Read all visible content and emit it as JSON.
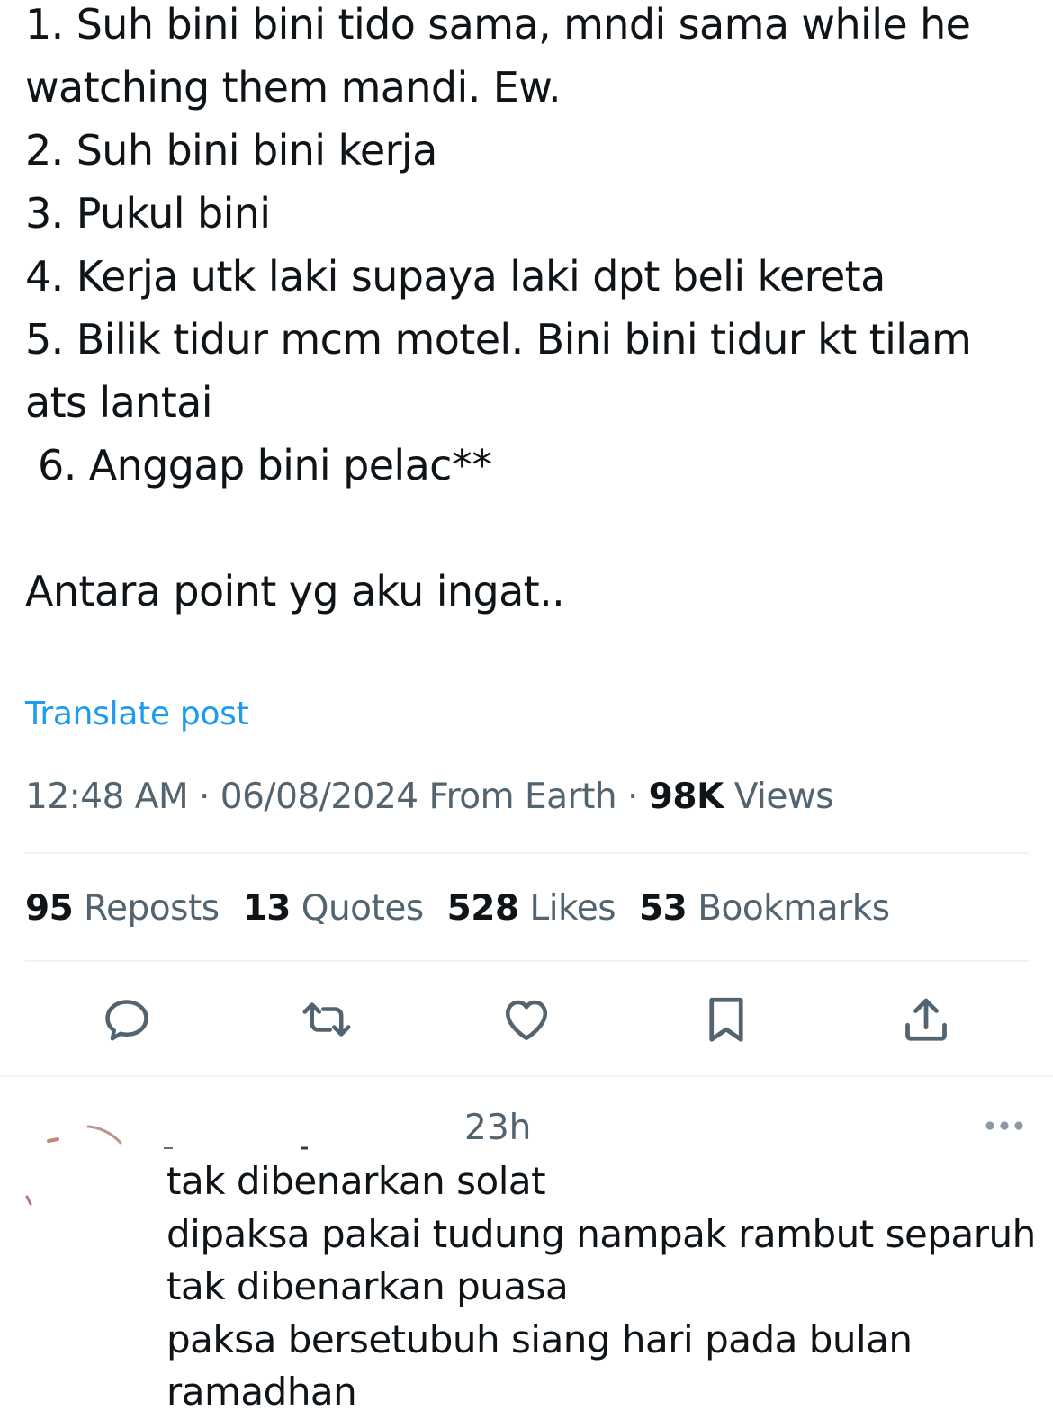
{
  "tweet": {
    "lines": [
      "1. Suh bini bini tido sama, mndi sama while he",
      "watching them mandi. Ew.",
      "2. Suh bini bini kerja",
      "3. Pukul bini",
      "4. Kerja utk laki supaya laki dpt beli kereta",
      "5. Bilik tidur mcm motel. Bini bini tidur kt tilam",
      "ats lantai",
      " 6. Anggap bini pelac**",
      "",
      "Antara point yg aku ingat.."
    ],
    "translate_label": "Translate post",
    "timestamp": "12:48 AM · 06/08/2024 From Earth · ",
    "views_count": "98K",
    "views_label": " Views"
  },
  "stats": {
    "reposts_count": "95",
    "reposts_label": " Reposts",
    "quotes_count": "13",
    "quotes_label": " Quotes",
    "likes_count": "528",
    "likes_label": " Likes",
    "bookmarks_count": "53",
    "bookmarks_label": " Bookmarks"
  },
  "actions": {
    "icons": [
      "reply-icon",
      "repost-icon",
      "like-icon",
      "bookmark-icon",
      "share-icon"
    ]
  },
  "reply": {
    "time": "23h",
    "lines": [
      "tak dibenarkan solat",
      "dipaksa pakai tudung nampak rambut separuh",
      "tak dibenarkan puasa",
      "paksa bersetubuh siang hari pada bulan",
      "ramadhan"
    ]
  },
  "colors": {
    "text": "#0f1419",
    "secondary": "#536471",
    "link": "#1d9bf0",
    "divider": "#eff3f4"
  }
}
